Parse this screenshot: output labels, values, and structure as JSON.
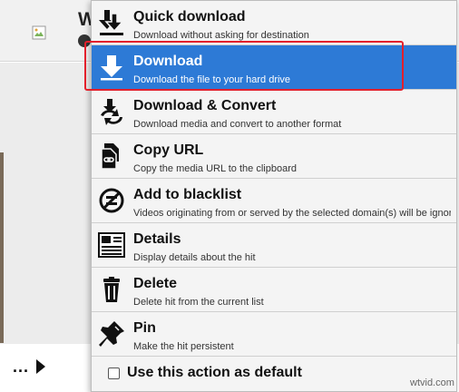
{
  "background": {
    "title_fragment": "W"
  },
  "menu": {
    "items": [
      {
        "label": "Quick download",
        "description": "Download without asking for destination",
        "icon": "quick-download-icon"
      },
      {
        "label": "Download",
        "description": "Download the file to your hard drive",
        "icon": "download-icon",
        "selected": true
      },
      {
        "label": "Download & Convert",
        "description": "Download media and convert to another format",
        "icon": "download-convert-icon"
      },
      {
        "label": "Copy URL",
        "description": "Copy the media URL to the clipboard",
        "icon": "copy-url-icon"
      },
      {
        "label": "Add to blacklist",
        "description": "Videos originating from or served by the selected domain(s) will be ignor...",
        "icon": "blacklist-icon"
      },
      {
        "label": "Details",
        "description": "Display details about the hit",
        "icon": "details-icon"
      },
      {
        "label": "Delete",
        "description": "Delete hit from the current list",
        "icon": "delete-icon"
      },
      {
        "label": "Pin",
        "description": "Make the hit persistent",
        "icon": "pin-icon"
      }
    ],
    "footer": {
      "checkbox_label": "Use this action as default",
      "checked": false
    }
  },
  "bottom_bar": {
    "more_label": "..."
  },
  "watermark": "wtvid.com",
  "colors": {
    "selected_bg": "#2d7ad6",
    "highlight_border": "#e3202c"
  }
}
